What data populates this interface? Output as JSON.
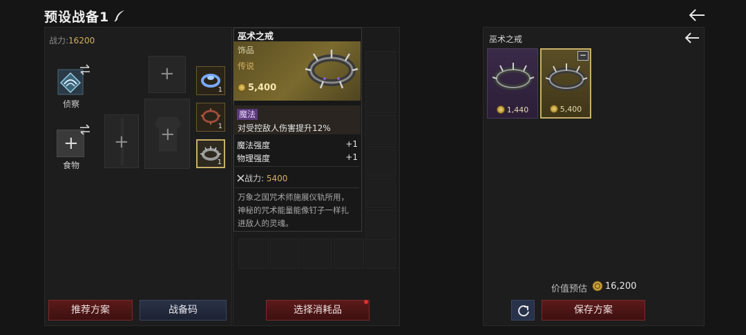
{
  "header": {
    "title": "预设战备1"
  },
  "left": {
    "power_label": "战力:",
    "power_value": "16200",
    "scout_label": "侦察",
    "food_label": "食物",
    "slots": [
      {
        "count": "1"
      },
      {
        "count": "1"
      },
      {
        "count": "1"
      }
    ],
    "recommend_button": "推荐方案",
    "code_button": "战备码"
  },
  "middle": {
    "consumables_button": "选择消耗品"
  },
  "tooltip": {
    "name": "巫术之戒",
    "type": "饰品",
    "rarity": "传说",
    "price": "5,400",
    "magic_tag": "魔法",
    "magic_desc": "对受控敌人伤害提升12%",
    "stats": [
      {
        "name": "魔法强度",
        "value": "+1"
      },
      {
        "name": "物理强度",
        "value": "+1"
      }
    ],
    "power_label": "战力: ",
    "power_value": "5400",
    "lore": "万象之国咒术师施展仪轨所用，神秘的咒术能量能像钉子一样扎进敌人的灵魂。"
  },
  "right": {
    "title": "巫术之戒",
    "cards": [
      {
        "price": "1,440"
      },
      {
        "price": "5,400"
      }
    ],
    "estimate_label": "价值预估",
    "estimate_value": "16,200",
    "save_button": "保存方案"
  }
}
